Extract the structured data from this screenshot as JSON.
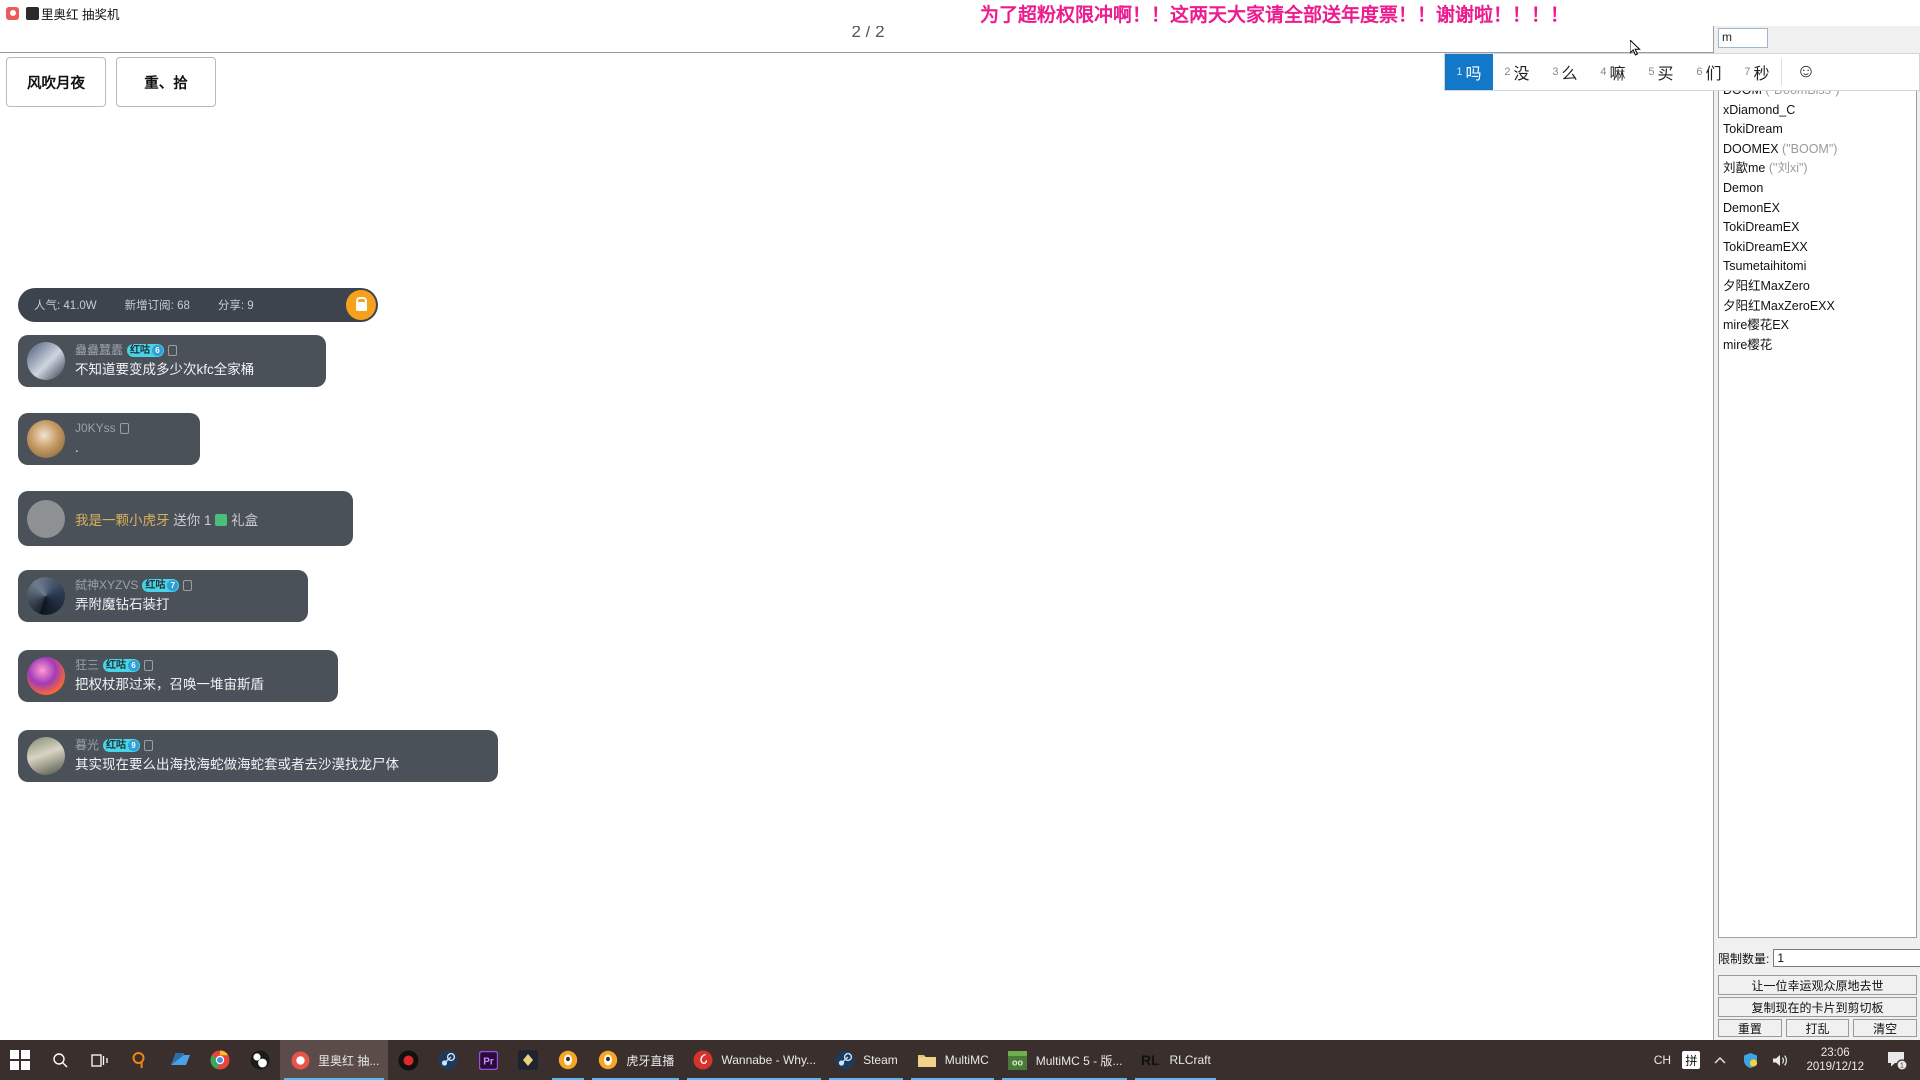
{
  "window": {
    "title": "里奥红 抽奖机",
    "app_icon": "record-icon",
    "user_badge_icon": "user-avatar-icon",
    "mute_icon": "no-sound-icon"
  },
  "banner": {
    "text": "为了超粉权限冲啊！！这两天大家请全部送年度票！！谢谢啦！！！！",
    "color": "#ec1c8f"
  },
  "lottery": {
    "page_counter": "2 / 2",
    "cards": [
      {
        "name": "风吹月夜"
      },
      {
        "name": "重、拾"
      }
    ],
    "participants": [
      {
        "name": "DOOM",
        "alias": "(\"DoomBiss\")"
      },
      {
        "name": "xDiamond_C",
        "alias": ""
      },
      {
        "name": "TokiDream",
        "alias": ""
      },
      {
        "name": "DOOMEX",
        "alias": "(\"BOOM\")"
      },
      {
        "name": "刘歖me",
        "alias": "(\"刘xi\")"
      },
      {
        "name": "Demon",
        "alias": ""
      },
      {
        "name": "DemonEX",
        "alias": ""
      },
      {
        "name": "TokiDreamEX",
        "alias": ""
      },
      {
        "name": "TokiDreamEXX",
        "alias": ""
      },
      {
        "name": "Tsumetaihitomi",
        "alias": ""
      },
      {
        "name": "夕阳红MaxZero",
        "alias": ""
      },
      {
        "name": "夕阳红MaxZeroEXX",
        "alias": ""
      },
      {
        "name": "mire樱花EX",
        "alias": ""
      },
      {
        "name": "mire樱花",
        "alias": ""
      }
    ],
    "limit_label": "限制数量:",
    "limit_value": "1",
    "draw_button": "让一位幸运观众原地去世",
    "copy_button": "复制现在的卡片到剪切板",
    "reset_button": "重置",
    "shuffle_button": "打乱",
    "clear_button": "清空"
  },
  "ime": {
    "composing": "m",
    "candidates": [
      {
        "num": "1",
        "word": "吗",
        "active": true
      },
      {
        "num": "2",
        "word": "没",
        "active": false
      },
      {
        "num": "3",
        "word": "么",
        "active": false
      },
      {
        "num": "4",
        "word": "嘛",
        "active": false
      },
      {
        "num": "5",
        "word": "买",
        "active": false
      },
      {
        "num": "6",
        "word": "们",
        "active": false
      },
      {
        "num": "7",
        "word": "秒",
        "active": false
      }
    ],
    "emoji_icon": "smiley-face-icon"
  },
  "stream": {
    "stats": [
      {
        "label": "人气:",
        "value": "41.0W"
      },
      {
        "label": "新增订阅:",
        "value": "68"
      },
      {
        "label": "分享:",
        "value": "9"
      }
    ],
    "lock_icon": "lock-icon",
    "messages": [
      {
        "user": "蠱蠱蠶蠹",
        "badge": "红咕",
        "level": "6",
        "mobile": true,
        "text": "不知道要变成多少次kfc全家桶",
        "type": "chat"
      },
      {
        "user": "J0KYss",
        "badge": "",
        "level": "",
        "mobile": true,
        "text": ".",
        "type": "chat"
      },
      {
        "user": "我是一颗小虎牙",
        "badge": "",
        "level": "",
        "mobile": false,
        "text": "送你 1 礼盒",
        "type": "gift",
        "gift_count": "1",
        "gift_name": "礼盒",
        "gift_verb": "送你"
      },
      {
        "user": "弑神XYZVS",
        "badge": "红咕",
        "level": "7",
        "mobile": true,
        "text": "弄附魔钻石装打",
        "type": "chat"
      },
      {
        "user": "狂三",
        "badge": "红咕",
        "level": "6",
        "mobile": true,
        "text": "把权杖那过来，召唤一堆宙斯盾",
        "type": "chat"
      },
      {
        "user": "暮光",
        "badge": "红咕",
        "level": "9",
        "mobile": true,
        "text": "其实现在要么出海找海蛇做海蛇套或者去沙漠找龙尸体",
        "type": "chat"
      }
    ]
  },
  "taskbar": {
    "start_icon": "windows-start-icon",
    "items": [
      {
        "label": "",
        "icon": "search-icon",
        "state": "idle"
      },
      {
        "label": "",
        "icon": "task-view-icon",
        "state": "idle"
      },
      {
        "label": "",
        "icon": "everything-search-icon",
        "state": "idle"
      },
      {
        "label": "",
        "icon": "explorer-icon",
        "state": "idle"
      },
      {
        "label": "",
        "icon": "chrome-icon",
        "state": "idle"
      },
      {
        "label": "",
        "icon": "obs-icon",
        "state": "idle"
      },
      {
        "label": "里奥红 抽...",
        "icon": "record-icon",
        "state": "active"
      },
      {
        "label": "",
        "icon": "record-red-icon",
        "state": "idle"
      },
      {
        "label": "",
        "icon": "steam-icon",
        "state": "idle"
      },
      {
        "label": "",
        "icon": "premiere-icon",
        "state": "idle"
      },
      {
        "label": "",
        "icon": "dark-app-icon",
        "state": "idle"
      },
      {
        "label": "",
        "icon": "huya-icon",
        "state": "running"
      },
      {
        "label": "虎牙直播",
        "icon": "huya-icon",
        "state": "running"
      },
      {
        "label": "Wannabe - Why...",
        "icon": "netease-music-icon",
        "state": "running"
      },
      {
        "label": "Steam",
        "icon": "steam-icon",
        "state": "running"
      },
      {
        "label": "MultiMC",
        "icon": "folder-icon",
        "state": "running"
      },
      {
        "label": "MultiMC 5 - 版...",
        "icon": "multimc-icon",
        "state": "running"
      },
      {
        "label": "RLCraft",
        "icon": "rlcraft-icon",
        "state": "running"
      }
    ],
    "tray": {
      "lang": "CH",
      "ime_mode": "拼",
      "chevron_icon": "chevron-up-icon",
      "shield_icon": "security-shield-icon",
      "volume_icon": "volume-icon",
      "time": "23:06",
      "date": "2019/12/12",
      "notification_icon": "notification-icon",
      "notification_count": "1"
    }
  }
}
